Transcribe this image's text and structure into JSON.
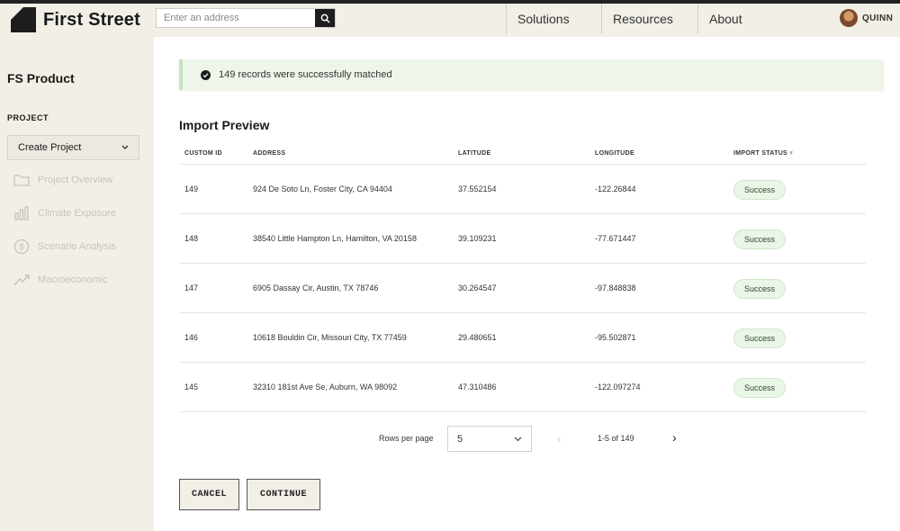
{
  "brand": {
    "name": "First Street"
  },
  "search": {
    "placeholder": "Enter an address"
  },
  "nav": {
    "items": [
      "Solutions",
      "Resources",
      "About"
    ]
  },
  "user": {
    "name": "QUINN"
  },
  "sidebar": {
    "product": "FS Product",
    "project_label": "PROJECT",
    "project_select": "Create Project",
    "items": [
      {
        "label": "Project Overview",
        "icon": "folder-icon"
      },
      {
        "label": "Climate Exposure",
        "icon": "bar-chart-icon"
      },
      {
        "label": "Scenario Analysis",
        "icon": "dollar-icon"
      },
      {
        "label": "Macroeconomic",
        "icon": "trend-icon"
      }
    ]
  },
  "alert": {
    "message": "149 records were successfully matched"
  },
  "table": {
    "title": "Import Preview",
    "columns": [
      "CUSTOM ID",
      "ADDRESS",
      "LATITUDE",
      "LONGITUDE",
      "IMPORT STATUS"
    ],
    "rows": [
      {
        "id": "149",
        "address": "924 De Soto Ln, Foster City, CA 94404",
        "lat": "37.552154",
        "lon": "-122.26844",
        "status": "Success"
      },
      {
        "id": "148",
        "address": "38540 Little Hampton Ln, Hamilton, VA 20158",
        "lat": "39.109231",
        "lon": "-77.671447",
        "status": "Success"
      },
      {
        "id": "147",
        "address": "6905 Dassay Cir, Austin, TX 78746",
        "lat": "30.264547",
        "lon": "-97.848838",
        "status": "Success"
      },
      {
        "id": "146",
        "address": "10618 Bouldin Cir, Missouri City, TX 77459",
        "lat": "29.480651",
        "lon": "-95.502871",
        "status": "Success"
      },
      {
        "id": "145",
        "address": "32310 181st Ave Se, Auburn, WA 98092",
        "lat": "47.310486",
        "lon": "-122.097274",
        "status": "Success"
      }
    ]
  },
  "pagination": {
    "rows_label": "Rows per page",
    "rows_value": "5",
    "range": "1-5 of 149"
  },
  "actions": {
    "cancel": "CANCEL",
    "continue": "CONTINUE"
  }
}
